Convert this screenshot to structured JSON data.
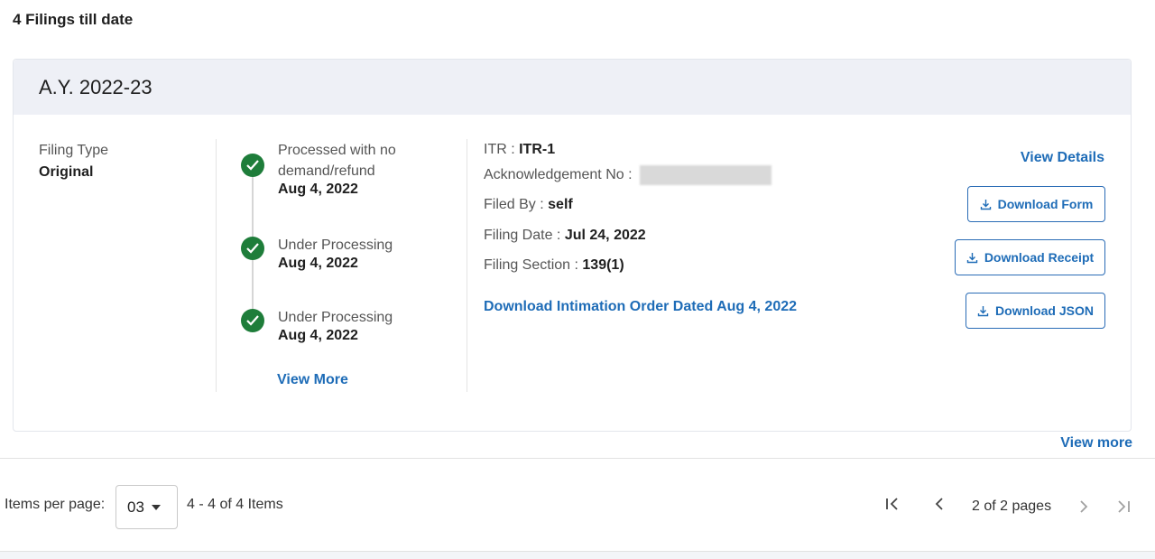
{
  "summary": {
    "filings_count_text": "4 Filings till date"
  },
  "card": {
    "assessment_year": "A.Y. 2022-23",
    "filing_type_label": "Filing Type",
    "filing_type_value": "Original",
    "timeline": [
      {
        "status": "Processed with no demand/refund",
        "date": "Aug 4, 2022"
      },
      {
        "status": "Under Processing",
        "date": "Aug 4, 2022"
      },
      {
        "status": "Under Processing",
        "date": "Aug 4, 2022"
      }
    ],
    "timeline_view_more": "View More",
    "details": {
      "itr_label": "ITR : ",
      "itr_value": "ITR-1",
      "ack_label": "Acknowledgement No : ",
      "filed_by_label": "Filed By : ",
      "filed_by_value": "self",
      "filing_date_label": "Filing Date : ",
      "filing_date_value": "Jul 24, 2022",
      "filing_section_label": "Filing Section : ",
      "filing_section_value": "139(1)",
      "intimation_link": "Download Intimation Order Dated Aug 4, 2022"
    },
    "actions": {
      "view_details": "View Details",
      "download_form": "Download Form",
      "download_receipt": "Download Receipt",
      "download_json": "Download JSON"
    }
  },
  "view_more_link": "View more",
  "pagination": {
    "items_per_page_label": "Items per page:",
    "items_per_page_value": "03",
    "range_text": "4 - 4 of 4 Items",
    "page_text": "2 of 2 pages"
  },
  "colors": {
    "accent": "#1e6cb7",
    "success": "#1e7d3a",
    "header_bg": "#eef0f6"
  }
}
